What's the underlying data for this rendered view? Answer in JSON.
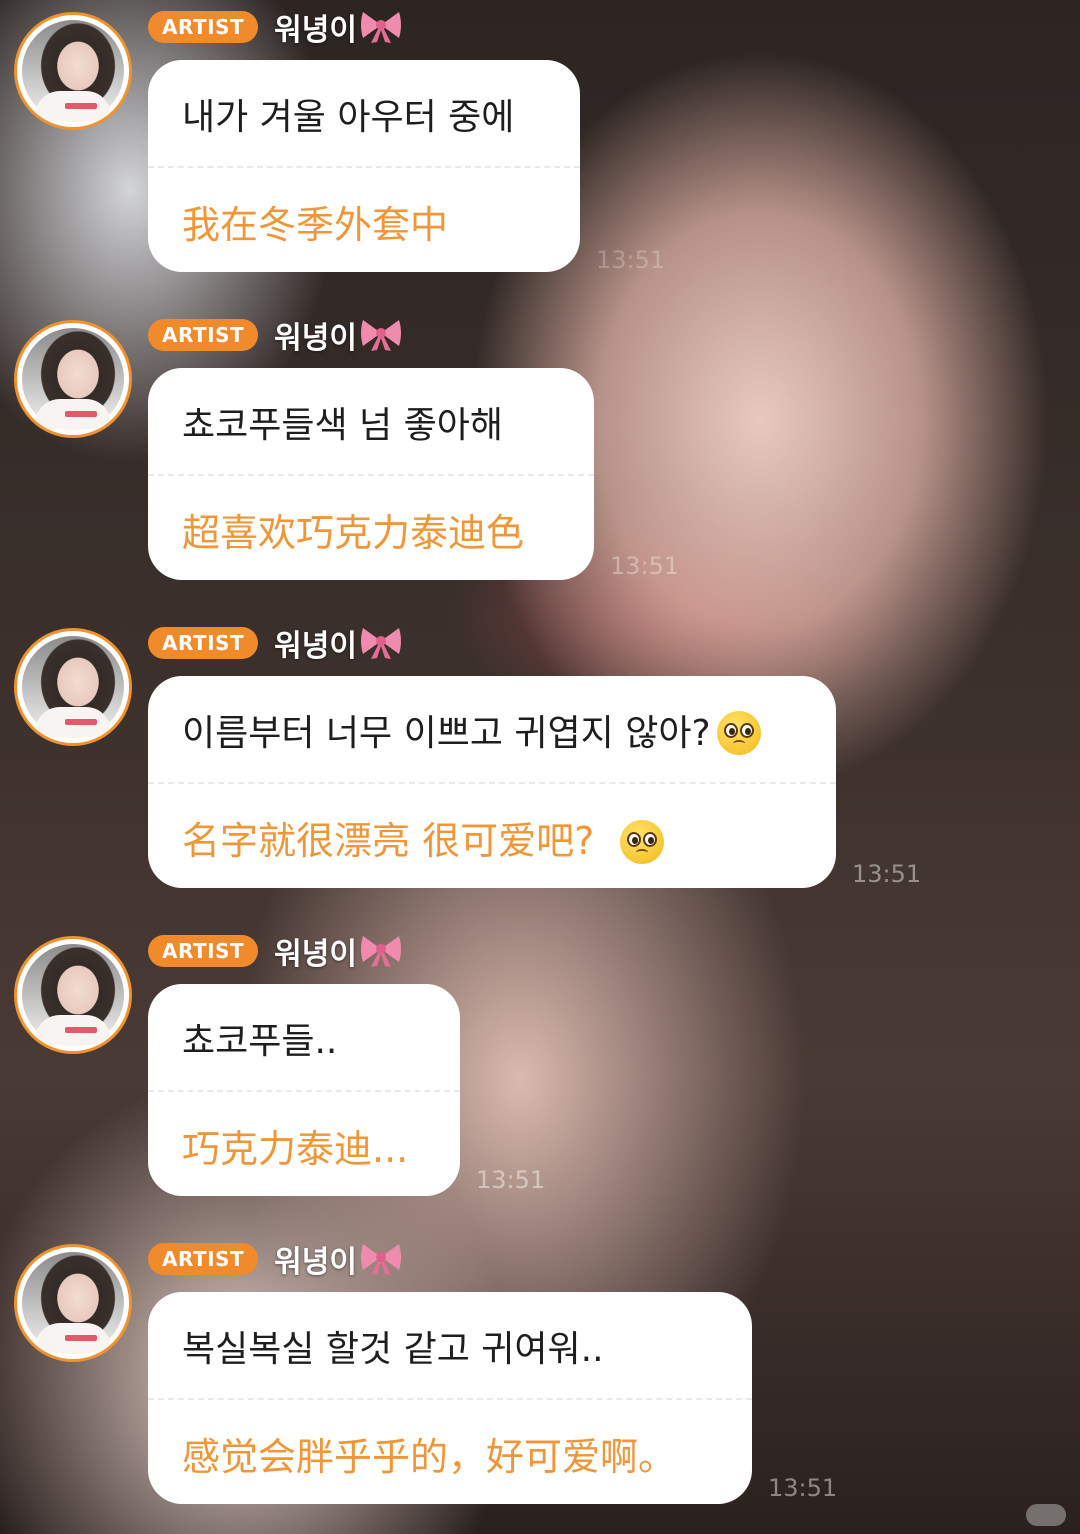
{
  "messages": [
    {
      "badge": "ARTIST",
      "name": "워녕이",
      "korean": "내가 겨울 아우터 중에",
      "chinese": "我在冬季外套中",
      "time": "13:51"
    },
    {
      "badge": "ARTIST",
      "name": "워녕이",
      "korean": "쵸코푸들색 넘 좋아해",
      "chinese": "超喜欢巧克力泰迪色",
      "time": "13:51"
    },
    {
      "badge": "ARTIST",
      "name": "워녕이",
      "korean": "이름부터 너무 이쁘고 귀엽지 않아?",
      "chinese": "名字就很漂亮 很可爱吧?",
      "emoji": "pleading-face-emoji",
      "time": "13:51"
    },
    {
      "badge": "ARTIST",
      "name": "워녕이",
      "korean": "쵸코푸들..",
      "chinese": "巧克力泰迪...",
      "time": "13:51"
    },
    {
      "badge": "ARTIST",
      "name": "워녕이",
      "korean": "복실복실 할것 같고 귀여워..",
      "chinese": "感觉会胖乎乎的，好可爱啊。",
      "time": "13:51"
    }
  ],
  "colors": {
    "badge": "#f08a2b",
    "avatar_ring": "#f0922e",
    "translation_text": "#ef9738",
    "bubble": "#ffffff",
    "bow": "#f08bb0"
  },
  "icons": {
    "name_suffix": "ribbon-bow-icon"
  }
}
